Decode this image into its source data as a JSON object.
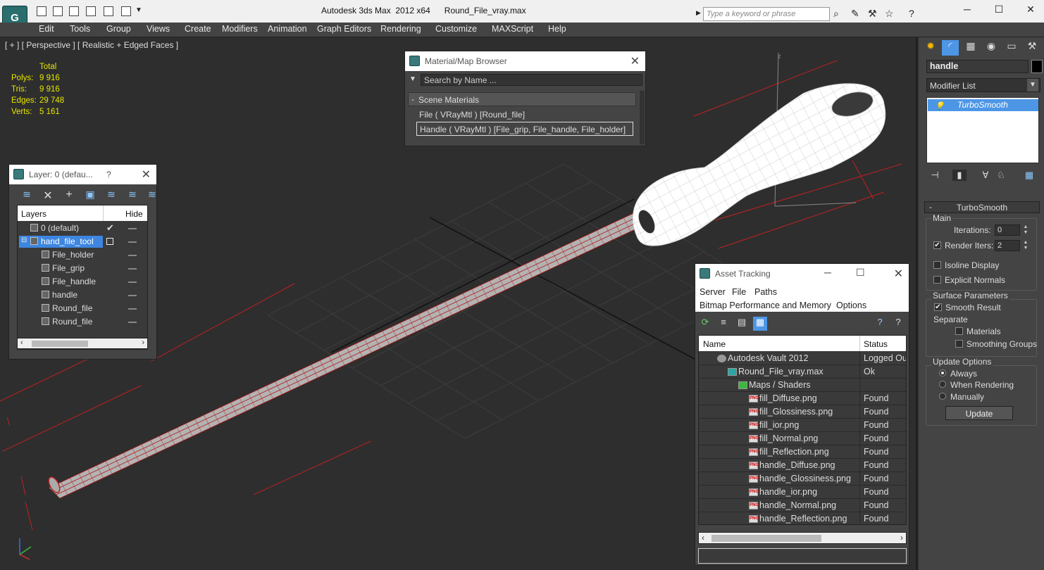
{
  "titlebar": {
    "app_title": "Autodesk 3ds Max  2012 x64",
    "file_name": "Round_File_vray.max",
    "search_placeholder": "Type a keyword or phrase",
    "logo_glyph": "G"
  },
  "menu": [
    "Edit",
    "Tools",
    "Group",
    "Views",
    "Create",
    "Modifiers",
    "Animation",
    "Graph Editors",
    "Rendering",
    "Customize",
    "MAXScript",
    "Help"
  ],
  "viewport": {
    "label": "[ + ] [ Perspective ] [ Realistic + Edged Faces ]",
    "stats_header": "Total",
    "stats": [
      {
        "key": "Polys:",
        "value": "9 916"
      },
      {
        "key": "Tris:",
        "value": "9 916"
      },
      {
        "key": "Edges:",
        "value": "29 748"
      },
      {
        "key": "Verts:",
        "value": "5 161"
      }
    ],
    "gizmo_z": "z"
  },
  "layer_panel": {
    "title": "Layer: 0 (defau...",
    "help": "?",
    "header_layers": "Layers",
    "header_hide": "Hide",
    "rows": [
      {
        "name": "0 (default)",
        "indent": 0,
        "selected": false
      },
      {
        "name": "hand_file_tool",
        "indent": 0,
        "selected": true
      },
      {
        "name": "File_holder",
        "indent": 1,
        "selected": false
      },
      {
        "name": "File_grip",
        "indent": 1,
        "selected": false
      },
      {
        "name": "File_handle",
        "indent": 1,
        "selected": false
      },
      {
        "name": "handle",
        "indent": 1,
        "selected": false
      },
      {
        "name": "Round_file",
        "indent": 1,
        "selected": false
      },
      {
        "name": "Round_file",
        "indent": 1,
        "selected": false
      }
    ]
  },
  "material_browser": {
    "title": "Material/Map Browser",
    "search_placeholder": "Search by Name ...",
    "section": "Scene Materials",
    "items": [
      "File  ( VRayMtl ) [Round_file]",
      "Handle  ( VRayMtl ) [File_grip, File_handle, File_holder]"
    ]
  },
  "asset_tracking": {
    "title": "Asset Tracking",
    "menus": [
      "Server",
      "File",
      "Paths",
      "Bitmap Performance and Memory",
      "Options"
    ],
    "col_name": "Name",
    "col_status": "Status",
    "rows": [
      {
        "name": "Autodesk Vault 2012",
        "status": "Logged Out",
        "indent": 0,
        "type": "vault"
      },
      {
        "name": "Round_File_vray.max",
        "status": "Ok",
        "indent": 1,
        "type": "max"
      },
      {
        "name": "Maps / Shaders",
        "status": "",
        "indent": 2,
        "type": "maps"
      },
      {
        "name": "fill_Diffuse.png",
        "status": "Found",
        "indent": 3,
        "type": "png"
      },
      {
        "name": "fill_Glossiness.png",
        "status": "Found",
        "indent": 3,
        "type": "png"
      },
      {
        "name": "fill_ior.png",
        "status": "Found",
        "indent": 3,
        "type": "png"
      },
      {
        "name": "fill_Normal.png",
        "status": "Found",
        "indent": 3,
        "type": "png"
      },
      {
        "name": "fill_Reflection.png",
        "status": "Found",
        "indent": 3,
        "type": "png"
      },
      {
        "name": "handle_Diffuse.png",
        "status": "Found",
        "indent": 3,
        "type": "png"
      },
      {
        "name": "handle_Glossiness.png",
        "status": "Found",
        "indent": 3,
        "type": "png"
      },
      {
        "name": "handle_ior.png",
        "status": "Found",
        "indent": 3,
        "type": "png"
      },
      {
        "name": "handle_Normal.png",
        "status": "Found",
        "indent": 3,
        "type": "png"
      },
      {
        "name": "handle_Reflection.png",
        "status": "Found",
        "indent": 3,
        "type": "png"
      }
    ]
  },
  "command_panel": {
    "object_name": "handle",
    "modifier_list": "Modifier List",
    "stack_item": "TurboSmooth",
    "rollout_title": "TurboSmooth",
    "main_group": "Main",
    "iterations_label": "Iterations:",
    "iterations_value": "0",
    "render_iters_label": "Render Iters:",
    "render_iters_value": "2",
    "render_iters_checked": true,
    "isoline_label": "Isoline Display",
    "isoline_checked": false,
    "explicit_label": "Explicit Normals",
    "explicit_checked": false,
    "surface_group": "Surface Parameters",
    "smooth_result_label": "Smooth Result",
    "smooth_result_checked": true,
    "separate_label": "Separate",
    "materials_label": "Materials",
    "materials_checked": false,
    "smoothing_groups_label": "Smoothing Groups",
    "smoothing_groups_checked": false,
    "update_group": "Update Options",
    "always_label": "Always",
    "when_rendering_label": "When Rendering",
    "manually_label": "Manually",
    "update_selected": "Always",
    "update_button": "Update"
  }
}
